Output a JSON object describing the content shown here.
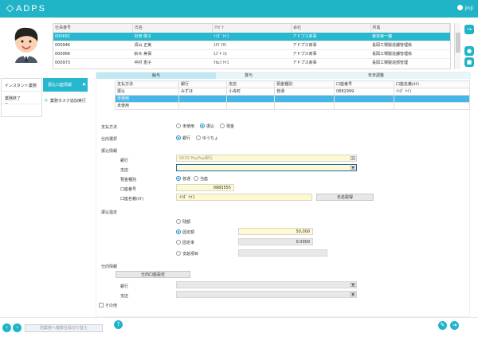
{
  "app": {
    "title": "ADPS",
    "user": "jinji"
  },
  "employee_table": {
    "headers": [
      "社員番号",
      "氏名",
      "ﾌﾘｶﾞﾅ",
      "会社",
      "所属"
    ],
    "rows": [
      [
        "000682",
        "石田 敬子",
        "ｲｼﾀﾞ ｹｲｺ",
        "アドプス商事",
        "東京第一課"
      ],
      [
        "000946",
        "須山 正美",
        "ｽﾔﾏ ﾏｻﾐ",
        "アドプス商事",
        "長岡工場製造課管理係"
      ],
      [
        "000966",
        "鈴木 美保",
        "ｽｽﾞｷ ﾐﾎ",
        "アドプス商事",
        "長岡工場製造課管理係"
      ],
      [
        "000973",
        "中村 恵子",
        "ﾅｶﾑﾗ ｹｲｺ",
        "アドプス商事",
        "長岡工場製造部管理"
      ]
    ]
  },
  "left_nav": {
    "item1": "インスタント業務",
    "item2": "業務終了",
    "item2_sub": "−",
    "active": "振込口座情報",
    "add_task": "業務タスク追加実行"
  },
  "tabs": [
    "給与",
    "賞与",
    "年末調整"
  ],
  "payment_table": {
    "headers": [
      "支払方法",
      "銀行",
      "支店",
      "預金種別",
      "口座番号",
      "口座名義(ｶﾅ)"
    ],
    "rows": [
      [
        "振込",
        "みずほ",
        "小舟町",
        "普通",
        "0882999",
        "ｲｼﾀﾞ ｹｲｺ"
      ],
      [
        "未使用",
        "",
        "",
        "",
        "",
        ""
      ],
      [
        "未使用",
        "",
        "",
        "",
        "",
        ""
      ]
    ]
  },
  "form": {
    "payment_method_label": "支払方法",
    "payment_method_options": [
      "未使用",
      "振込",
      "現金"
    ],
    "destination_label": "仕向選択",
    "destination_options": [
      "銀行",
      "ゆうちょ"
    ],
    "transfer_info_label": "振込情報",
    "bank_label": "銀行",
    "bank_value": "0033 PayPay銀行",
    "branch_label": "支店",
    "branch_value": "",
    "deposit_type_label": "預金種別",
    "deposit_type_options": [
      "普通",
      "当座"
    ],
    "account_number_label": "口座番号",
    "account_number_value": "0983555",
    "account_name_label": "口座名義(ｶﾅ)",
    "account_name_value": "ｲｼﾀﾞ ｹｲｺ",
    "name_fetch_button": "氏名取得",
    "transfer_spec_label": "振込指定",
    "transfer_options": [
      "残額",
      "固定額",
      "固定率",
      "支給項目"
    ],
    "fixed_amount_value": "50,000",
    "fixed_rate_value": "0.0000",
    "destination_info_label": "仕向情報",
    "destination_setting_button": "仕向口座設定",
    "other_label": "その他"
  },
  "footer": {
    "bulk_button": "別業務へ複数社員切り替え",
    "help": "?"
  }
}
